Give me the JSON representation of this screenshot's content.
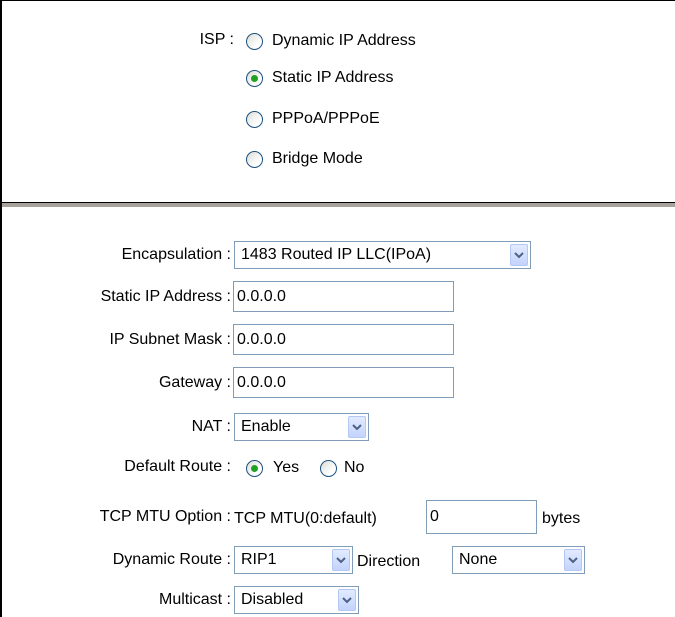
{
  "isp": {
    "label": "ISP :",
    "options": [
      {
        "label": "Dynamic IP Address",
        "checked": false
      },
      {
        "label": "Static IP Address",
        "checked": true
      },
      {
        "label": "PPPoA/PPPoE",
        "checked": false
      },
      {
        "label": "Bridge Mode",
        "checked": false
      }
    ]
  },
  "form": {
    "encapsulation": {
      "label": "Encapsulation :",
      "value": "1483 Routed IP LLC(IPoA)"
    },
    "static_ip": {
      "label": "Static IP Address :",
      "value": "0.0.0.0"
    },
    "subnet_mask": {
      "label": "IP Subnet Mask :",
      "value": "0.0.0.0"
    },
    "gateway": {
      "label": "Gateway :",
      "value": "0.0.0.0"
    },
    "nat": {
      "label": "NAT :",
      "value": "Enable"
    },
    "default_route": {
      "label": "Default Route :",
      "yes": "Yes",
      "no": "No",
      "selected": "Yes"
    },
    "tcp_mtu": {
      "label": "TCP MTU Option :",
      "prefix": "TCP MTU(0:default)",
      "value": "0",
      "unit": "bytes"
    },
    "dynamic_route": {
      "label": "Dynamic Route :",
      "value": "RIP1",
      "direction_label": "Direction",
      "direction_value": "None"
    },
    "multicast": {
      "label": "Multicast :",
      "value": "Disabled"
    }
  },
  "colors": {
    "radio_dot": "#21a121",
    "divider": "#a8a39a",
    "input_border": "#7f9db9"
  }
}
